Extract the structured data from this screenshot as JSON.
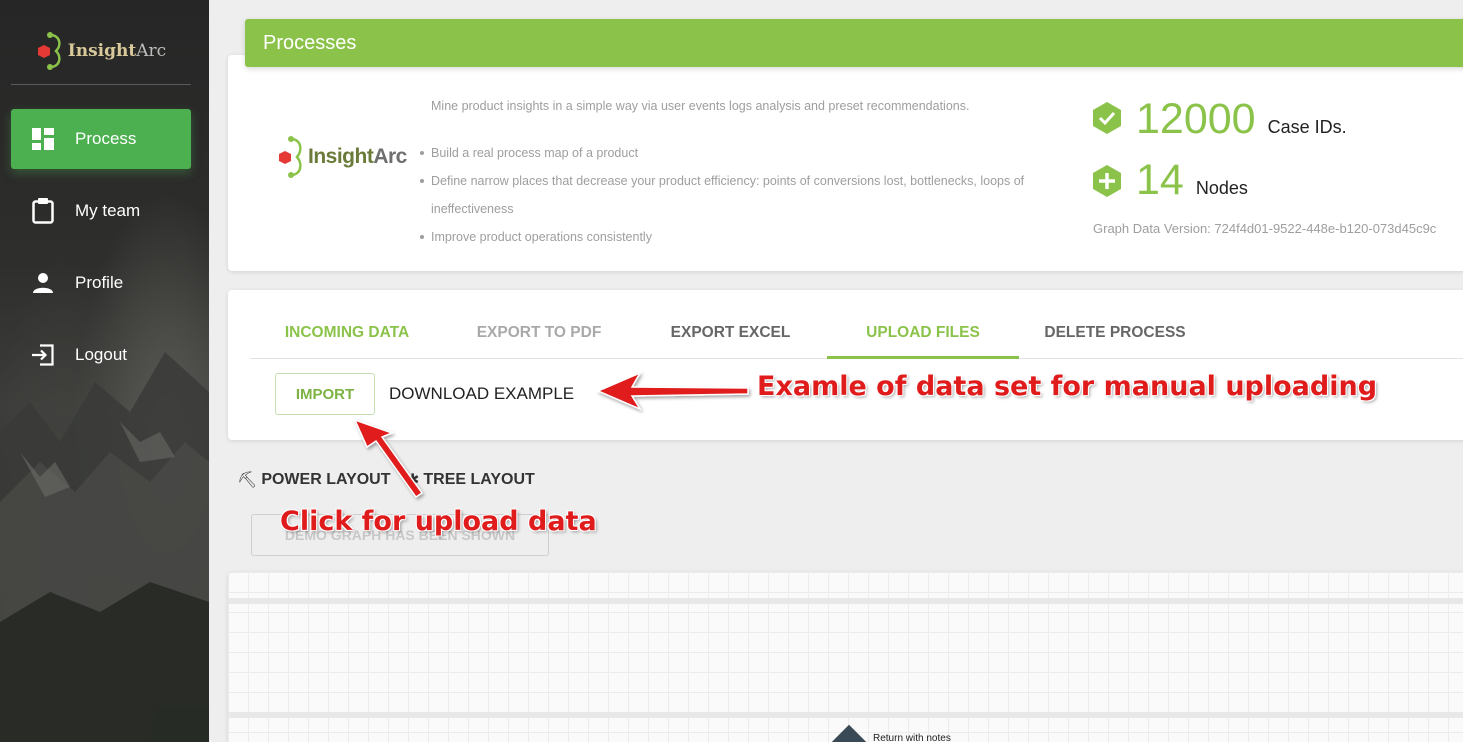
{
  "brand": {
    "name_part1": "Insight",
    "name_part2": "Arc"
  },
  "sidebar": {
    "items": [
      {
        "label": "Process",
        "icon": "dashboard-icon",
        "active": true
      },
      {
        "label": "My team",
        "icon": "clipboard-icon",
        "active": false
      },
      {
        "label": "Profile",
        "icon": "person-icon",
        "active": false
      },
      {
        "label": "Logout",
        "icon": "logout-icon",
        "active": false
      }
    ]
  },
  "header": {
    "title": "Processes"
  },
  "info": {
    "logo_part1": "Insight",
    "logo_part2": "Arc",
    "description": "Mine product insights in a simple way via user events logs analysis and preset recommendations.",
    "bullets": [
      "Build a real process map of a product",
      "Define narrow places that decrease your product efficiency: points of conversions lost, bottlenecks, loops of ineffectiveness",
      "Improve product operations consistently"
    ],
    "stats": [
      {
        "value": "12000",
        "unit": "Case IDs."
      },
      {
        "value": "14",
        "unit": "Nodes"
      }
    ],
    "graph_version": "Graph Data Version: 724f4d01-9522-448e-b120-073d45c9c"
  },
  "tabs": {
    "items": [
      {
        "label": "INCOMING DATA",
        "color": "#8bc34a"
      },
      {
        "label": "EXPORT TO PDF",
        "color": "#a9a9a9"
      },
      {
        "label": "EXPORT EXCEL",
        "color": "#666666"
      },
      {
        "label": "UPLOAD FILES",
        "color": "#8bc34a"
      },
      {
        "label": "DELETE PROCESS",
        "color": "#666666"
      }
    ],
    "active": "UPLOAD FILES",
    "import_label": "IMPORT",
    "download_label": "DOWNLOAD EXAMPLE"
  },
  "layout": {
    "power_label": "POWER LAYOUT",
    "tree_label": "TREE LAYOUT",
    "demo_button": "DEMO GRAPH HAS BEEN SHOWN"
  },
  "graph": {
    "node_label": "Return with notes"
  },
  "annotations": {
    "download_note": "Examle of data set for manual uploading",
    "import_note": "Click for upload data"
  },
  "colors": {
    "accent": "#8bc34a",
    "sidebar_active": "#4caf50",
    "annotation": "#e01b1b"
  }
}
